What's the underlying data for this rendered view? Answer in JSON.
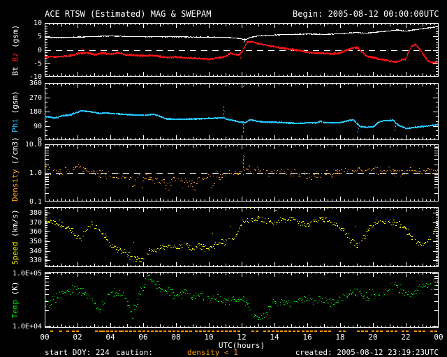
{
  "title": "ACE RTSW (Estimated) MAG & SWEPAM",
  "begin": "Begin: 2005-08-12 00:00:00UTC",
  "footer": {
    "start_doy": "start DOY: 224",
    "caution_label": "caution:",
    "caution_value": "density < 1",
    "created": "created: 2005-08-12 23:19:23UTC"
  },
  "x_axis": {
    "label": "UTC(hours)",
    "range_hours": [
      0,
      24
    ],
    "tick_labels": [
      "00",
      "02",
      "04",
      "06",
      "08",
      "10",
      "12",
      "14",
      "16",
      "18",
      "20",
      "22",
      "00"
    ]
  },
  "colors": {
    "background": "#000000",
    "frame": "#FFFFFF",
    "text": "#FFFFFF",
    "bt": "#FFFFFF",
    "bz": "#FF1414",
    "phi": "#25C3FF",
    "density": "#FFA01E",
    "speed": "#FFFF00",
    "temp": "#00E010",
    "caution": "#FF9900"
  },
  "caution_segments": [
    [
      0.35,
      0.55
    ],
    [
      0.9,
      1.15
    ],
    [
      1.3,
      1.5
    ],
    [
      1.65,
      1.95
    ],
    [
      3.05,
      3.35
    ],
    [
      3.5,
      4.55
    ],
    [
      4.65,
      5.6
    ],
    [
      5.7,
      6.3
    ],
    [
      6.45,
      7.45
    ],
    [
      7.55,
      9.0
    ],
    [
      9.15,
      10.35
    ],
    [
      10.45,
      11.9
    ],
    [
      12.6,
      13.1
    ],
    [
      13.3,
      14.2
    ],
    [
      14.35,
      15.5
    ],
    [
      15.65,
      16.6
    ],
    [
      16.75,
      17.3
    ],
    [
      17.9,
      18.35
    ],
    [
      19.0,
      19.55
    ],
    [
      19.9,
      20.45
    ],
    [
      20.8,
      21.35
    ],
    [
      21.75,
      22.15
    ],
    [
      22.5,
      23.25
    ],
    [
      23.5,
      23.9
    ]
  ],
  "chart_data": [
    {
      "name": "mag-bt-bz",
      "type": "line",
      "scale": "linear",
      "yrange": [
        -10,
        10
      ],
      "minor_step": 1,
      "dashed_at": 0,
      "yticks": [
        {
          "v": 10,
          "label": "10"
        },
        {
          "v": 5,
          "label": "5"
        },
        {
          "v": 0,
          "label": "0"
        },
        {
          "v": -5,
          "label": "-5"
        },
        {
          "v": -10,
          "label": "-10"
        }
      ],
      "ylabel_parts": [
        {
          "text": "Bt ",
          "color_key": "bt"
        },
        {
          "text": "Bz",
          "color_key": "bz"
        },
        {
          "text": " (gsm)",
          "color_key": "text"
        }
      ],
      "series": [
        {
          "name": "Bt",
          "color_key": "bt",
          "style": "line",
          "dot": 1,
          "jitter": 0.12,
          "x": [
            0,
            1,
            2,
            3,
            4,
            5,
            6,
            7,
            8,
            9,
            10,
            11,
            11.5,
            12,
            12.2,
            12.5,
            13,
            14,
            15,
            16,
            17,
            18,
            18.5,
            19,
            19.5,
            20,
            20.5,
            21,
            21.5,
            22,
            22.5,
            23,
            23.5,
            24
          ],
          "y": [
            4.8,
            4.7,
            4.9,
            5.1,
            5.3,
            5.1,
            5.0,
            5.0,
            5.0,
            4.9,
            4.9,
            4.8,
            4.6,
            4.2,
            3.8,
            4.8,
            5.3,
            5.7,
            5.9,
            6.0,
            5.9,
            6.1,
            6.4,
            6.6,
            6.3,
            6.6,
            6.9,
            7.2,
            7.5,
            7.1,
            7.6,
            8.0,
            8.4,
            8.8
          ],
          "spikes": [
            [
              12.15,
              2.6,
              4.2
            ]
          ]
        },
        {
          "name": "Bz",
          "color_key": "bz",
          "style": "line",
          "dot": 2,
          "jitter": 0.3,
          "x": [
            0,
            0.5,
            1,
            1.5,
            2,
            2.5,
            3,
            3.5,
            4,
            4.5,
            5,
            5.5,
            6,
            6.5,
            7,
            7.5,
            8,
            8.5,
            9,
            9.5,
            10,
            10.5,
            11,
            11.3,
            11.8,
            12,
            12.3,
            12.6,
            13,
            13.5,
            14,
            14.5,
            15,
            15.5,
            16,
            16.5,
            17,
            17.5,
            18,
            18.5,
            19,
            19.3,
            19.6,
            20,
            20.5,
            21,
            21.5,
            22,
            22.3,
            22.6,
            23,
            23.3,
            23.6,
            24
          ],
          "y": [
            -2.3,
            -2.4,
            -2.2,
            -2.0,
            -1.2,
            -0.8,
            -1.5,
            -1.0,
            -1.3,
            -0.9,
            -1.6,
            -1.8,
            -2.0,
            -1.8,
            -2.2,
            -2.6,
            -2.4,
            -2.7,
            -2.9,
            -3.0,
            -3.2,
            -2.8,
            -2.2,
            -1.0,
            -1.6,
            -0.5,
            3.0,
            3.3,
            2.6,
            2.0,
            1.4,
            0.9,
            0.4,
            0.0,
            -0.6,
            -1.0,
            -1.1,
            -1.3,
            -0.9,
            0.5,
            1.2,
            -0.5,
            -2.0,
            -2.6,
            -3.3,
            -3.9,
            -4.2,
            -3.0,
            1.5,
            2.3,
            -1.0,
            -3.8,
            -4.5,
            -4.2
          ],
          "spikes": [
            [
              2.3,
              -0.3,
              0.6
            ],
            [
              11.9,
              -3.6,
              -2.2
            ]
          ]
        }
      ]
    },
    {
      "name": "phi",
      "type": "line",
      "scale": "linear",
      "yrange": [
        0,
        360
      ],
      "minor_step": 30,
      "yticks": [
        {
          "v": 360,
          "label": "360"
        },
        {
          "v": 270,
          "label": "270"
        },
        {
          "v": 180,
          "label": "180"
        },
        {
          "v": 90,
          "label": "90"
        },
        {
          "v": 0,
          "label": "0"
        }
      ],
      "ylabel_parts": [
        {
          "text": "Phi",
          "color_key": "phi"
        },
        {
          "text": " (gsm)",
          "color_key": "text"
        }
      ],
      "series": [
        {
          "name": "Phi",
          "color_key": "phi",
          "style": "line",
          "dot": 2,
          "jitter": 2.5,
          "x": [
            0,
            0.3,
            0.6,
            0.8,
            1,
            1.5,
            2,
            2.2,
            2.5,
            3,
            3.3,
            3.7,
            4,
            4.5,
            5,
            5.5,
            6,
            6.6,
            7,
            7.3,
            7.5,
            8,
            8.5,
            9,
            9.5,
            10,
            10.5,
            10.9,
            11.2,
            11.5,
            11.9,
            12.2,
            12.5,
            13,
            13.5,
            14,
            14.5,
            15,
            15.5,
            16,
            16.5,
            16.8,
            17,
            17.5,
            18,
            18.5,
            18.8,
            19.2,
            19.6,
            20,
            20.4,
            20.7,
            21,
            21.2,
            21.5,
            22,
            22.5,
            23,
            23.5,
            24
          ],
          "y": [
            153,
            150,
            143,
            148,
            158,
            163,
            180,
            190,
            185,
            180,
            172,
            176,
            172,
            169,
            166,
            163,
            161,
            167,
            155,
            141,
            138,
            137,
            136,
            138,
            139,
            141,
            143,
            145,
            133,
            128,
            118,
            115,
            132,
            122,
            118,
            117,
            115,
            112,
            110,
            114,
            112,
            124,
            115,
            113,
            114,
            128,
            132,
            90,
            86,
            88,
            122,
            128,
            126,
            132,
            100,
            78,
            84,
            90,
            96,
            103
          ],
          "spikes": [
            [
              10.9,
              148,
              215
            ],
            [
              12.07,
              50,
              118
            ],
            [
              12.12,
              340,
              356
            ],
            [
              19.05,
              45,
              92
            ],
            [
              21.35,
              62,
              112
            ]
          ]
        }
      ]
    },
    {
      "name": "density",
      "type": "scatter",
      "scale": "log",
      "yrange": [
        0.1,
        10
      ],
      "dashed_at": 1.0,
      "yticks": [
        {
          "v": 10,
          "label": "10.0"
        },
        {
          "v": 1,
          "label": "1.0"
        },
        {
          "v": 0.1,
          "label": "0.1"
        }
      ],
      "ylabel_parts": [
        {
          "text": "Density",
          "color_key": "density"
        },
        {
          "text": " (/cm3)",
          "color_key": "text"
        }
      ],
      "series": [
        {
          "name": "Density",
          "color_key": "density",
          "style": "scatter",
          "dot": 1,
          "spread": 0.16,
          "step": 0.045,
          "skip": 0.25,
          "snap": true,
          "low_tail": [
            4.5,
            10.5,
            0.18
          ],
          "x": [
            0,
            0.5,
            1,
            1.5,
            2,
            2.5,
            3,
            3.5,
            4,
            4.5,
            5,
            5.5,
            6,
            6.5,
            7,
            7.5,
            8,
            8.5,
            9,
            9.5,
            10,
            10.5,
            11,
            11.5,
            12,
            12.3,
            12.6,
            13,
            13.5,
            14,
            14.5,
            15,
            15.5,
            16,
            16.5,
            17,
            17.5,
            18,
            18.5,
            19,
            19.5,
            20,
            20.5,
            21,
            21.5,
            22,
            22.5,
            23,
            23.5,
            24
          ],
          "y": [
            1.3,
            1.2,
            1.1,
            1.4,
            1.7,
            1.2,
            1.0,
            0.9,
            0.8,
            0.75,
            0.7,
            0.65,
            0.7,
            0.62,
            0.6,
            0.55,
            0.6,
            0.52,
            0.5,
            0.55,
            0.7,
            0.8,
            0.9,
            0.95,
            1.1,
            1.5,
            1.3,
            1.2,
            1.0,
            1.05,
            0.95,
            1.0,
            0.9,
            0.8,
            0.78,
            0.85,
            1.0,
            1.2,
            1.3,
            1.4,
            1.3,
            1.2,
            1.3,
            1.15,
            1.1,
            1.2,
            1.15,
            1.2,
            1.1,
            1.15
          ],
          "spikes": [
            [
              12.1,
              1.3,
              4.2
            ]
          ]
        }
      ]
    },
    {
      "name": "speed",
      "type": "scatter",
      "scale": "linear",
      "yrange": [
        323,
        386
      ],
      "minor_step": 2,
      "yticks": [
        {
          "v": 380,
          "label": "380"
        },
        {
          "v": 370,
          "label": "370"
        },
        {
          "v": 360,
          "label": "360"
        },
        {
          "v": 350,
          "label": "350"
        },
        {
          "v": 340,
          "label": "340"
        },
        {
          "v": 330,
          "label": "330"
        }
      ],
      "ylabel_parts": [
        {
          "text": "Speed",
          "color_key": "speed"
        },
        {
          "text": " (km/s)",
          "color_key": "text"
        }
      ],
      "series": [
        {
          "name": "Speed",
          "color_key": "speed",
          "style": "scatter",
          "dot": 1,
          "spread": 4,
          "step": 0.04,
          "skip": 0.2,
          "outliers": 0.015,
          "x": [
            0,
            0.5,
            1,
            1.5,
            2,
            2.2,
            2.5,
            2.8,
            3.2,
            3.6,
            4,
            4.5,
            5,
            5.5,
            6,
            6.5,
            7,
            7.5,
            8,
            8.5,
            9,
            9.5,
            10,
            10.5,
            11,
            11.5,
            11.8,
            12,
            12.5,
            13,
            13.5,
            14,
            14.5,
            15,
            15.5,
            16,
            16.5,
            17,
            17.5,
            18,
            18.5,
            19,
            19.3,
            19.6,
            20,
            20.5,
            21,
            21.5,
            22,
            22.3,
            22.7,
            23,
            23.3,
            23.6,
            24
          ],
          "y": [
            373,
            371,
            368,
            363,
            356,
            352,
            361,
            369,
            364,
            356,
            347,
            341,
            337,
            332,
            333,
            341,
            343,
            347,
            344,
            348,
            343,
            346,
            342,
            348,
            350,
            355,
            362,
            370,
            373,
            374,
            372,
            370,
            373,
            374,
            371,
            367,
            372,
            374,
            370,
            365,
            355,
            345,
            350,
            360,
            368,
            372,
            371,
            369,
            362,
            355,
            349,
            346,
            350,
            358,
            368
          ]
        }
      ]
    },
    {
      "name": "temp",
      "type": "scatter",
      "scale": "log",
      "yrange": [
        9400,
        106500
      ],
      "yticks": [
        {
          "v": 100000,
          "label": "1.0E+05"
        },
        {
          "v": 10000,
          "label": "1.0E+04"
        }
      ],
      "ylabel_parts": [
        {
          "text": "Temp",
          "color_key": "temp"
        },
        {
          "text": " (K)",
          "color_key": "text"
        }
      ],
      "series": [
        {
          "name": "Temp",
          "color_key": "temp",
          "style": "scatter",
          "dot": 1,
          "spread": 0.11,
          "step": 0.04,
          "skip": 0.15,
          "x": [
            0,
            0.5,
            1,
            1.5,
            2,
            2.5,
            3,
            3.3,
            3.6,
            4,
            4.5,
            5,
            5.3,
            5.6,
            6,
            6.3,
            6.6,
            7,
            7.5,
            8,
            8.5,
            9,
            9.5,
            10,
            10.5,
            11,
            11.5,
            12,
            12.5,
            13,
            13.5,
            14,
            14.5,
            15,
            15.5,
            16,
            16.5,
            17,
            17.5,
            18,
            18.5,
            19,
            19.5,
            20,
            20.5,
            21,
            21.3,
            21.7,
            22,
            22.5,
            23,
            23.5,
            24
          ],
          "y": [
            25000,
            32000,
            40000,
            48000,
            50000,
            45000,
            26000,
            21000,
            30000,
            45000,
            42000,
            30000,
            17000,
            25000,
            60000,
            85000,
            70000,
            52000,
            45000,
            40000,
            46000,
            35000,
            38000,
            32000,
            35000,
            30000,
            33000,
            35000,
            20000,
            13000,
            20000,
            28000,
            30000,
            27000,
            30000,
            33000,
            30000,
            34000,
            28000,
            32000,
            40000,
            46000,
            38000,
            42000,
            36000,
            52000,
            60000,
            50000,
            40000,
            45000,
            55000,
            60000,
            65000
          ]
        }
      ]
    }
  ]
}
